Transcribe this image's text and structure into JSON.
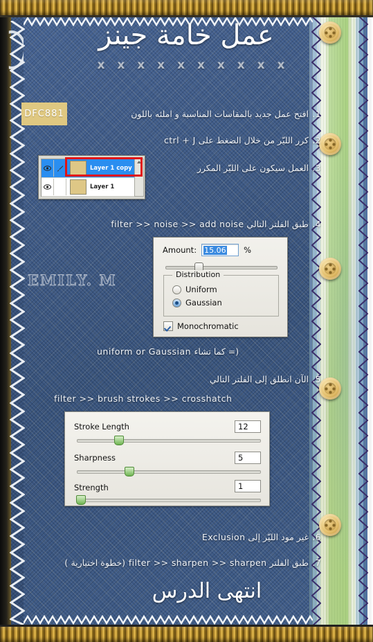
{
  "document": {
    "title": "عمل خامة جينز",
    "decorative_x_row": "x x x x x x x x x x",
    "closing": "انتهى الدرس",
    "watermark": "EMILY. M"
  },
  "palette": {
    "denim": "#3d5a86",
    "swatch_color": "#DFC881",
    "ribbon_green": "#a8d07f",
    "button_gold": "#e3bf6c",
    "highlight_red": "#e11414",
    "selection_blue": "#2a8ef0"
  },
  "color_swatch": {
    "hex_label": "DFC881"
  },
  "steps": [
    {
      "number": "1.",
      "text": "افتح عمل جديد بالمقاسات المناسبة و املئه باللون"
    },
    {
      "number": "2.",
      "text": "كرر الليّر من خلال الضغط على ctrl + J"
    },
    {
      "number": "3.",
      "text": "العمل سيكون على الليّر المكرر"
    },
    {
      "number": "4.",
      "text": "طبق الفلتر التالي filter >> noise >> add noise"
    },
    {
      "number": "5.",
      "text": "الآن انطلق إلى الفلتر التالي"
    },
    {
      "number": "6.",
      "text": "غير مود الليّر إلى Exclusion"
    },
    {
      "number": "7.",
      "text": "طبق الفلتر filter >> sharpen >> sharpen (خطوة اختيارية )"
    }
  ],
  "notes": {
    "uniform_or_gaussian": "uniform or Gaussian كما تشاء  =)",
    "crosshatch_path": "filter >> brush strokes >> crosshatch"
  },
  "layers_panel": {
    "rows": [
      {
        "name": "Layer 1 copy",
        "selected": true,
        "visible": true,
        "has_brush_icon": true
      },
      {
        "name": "Layer 1",
        "selected": false,
        "visible": true,
        "has_brush_icon": false
      }
    ]
  },
  "add_noise_dialog": {
    "amount_label": "Amount:",
    "amount_value": "15.06",
    "percent_symbol": "%",
    "distribution_group_label": "Distribution",
    "options": [
      {
        "label": "Uniform",
        "selected": false
      },
      {
        "label": "Gaussian",
        "selected": true
      }
    ],
    "monochromatic_label": "Monochromatic",
    "monochromatic_checked": true
  },
  "crosshatch_dialog": {
    "controls": [
      {
        "label": "Stroke Length",
        "value": "12",
        "slider_pct": 22
      },
      {
        "label": "Sharpness",
        "value": "5",
        "slider_pct": 33
      },
      {
        "label": "Strength",
        "value": "1",
        "slider_pct": 2
      }
    ]
  }
}
